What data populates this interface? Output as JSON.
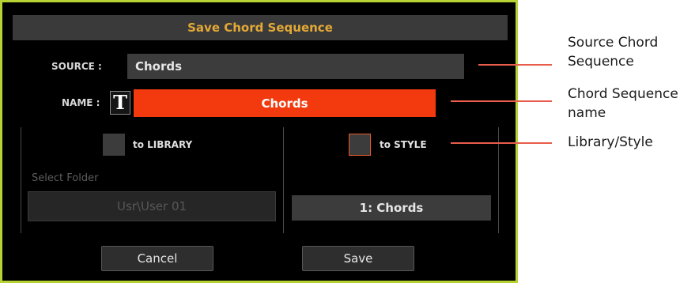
{
  "dialog": {
    "title": "Save Chord Sequence",
    "source_label": "SOURCE :",
    "source_value": "Chords",
    "name_label": "NAME :",
    "text_edit_button": "T",
    "name_value": "Chords",
    "to_library_label": "to LIBRARY",
    "to_style_label": "to STYLE",
    "to_library_checked": false,
    "to_style_checked": true,
    "select_folder_label": "Select Folder",
    "folder_value": "Usr\\User 01",
    "style_slot_value": "1: Chords",
    "cancel_label": "Cancel",
    "save_label": "Save"
  },
  "callouts": {
    "source": {
      "line1": "Source Chord",
      "line2": "Sequence"
    },
    "name": {
      "line1": "Chord Sequence",
      "line2": "name"
    },
    "library_style": {
      "line1": "Library/Style"
    }
  },
  "colors": {
    "frame": "#b5d332",
    "title_text": "#e3a836",
    "name_field": "#f23a0e",
    "callout_line": "#e85d4b"
  }
}
